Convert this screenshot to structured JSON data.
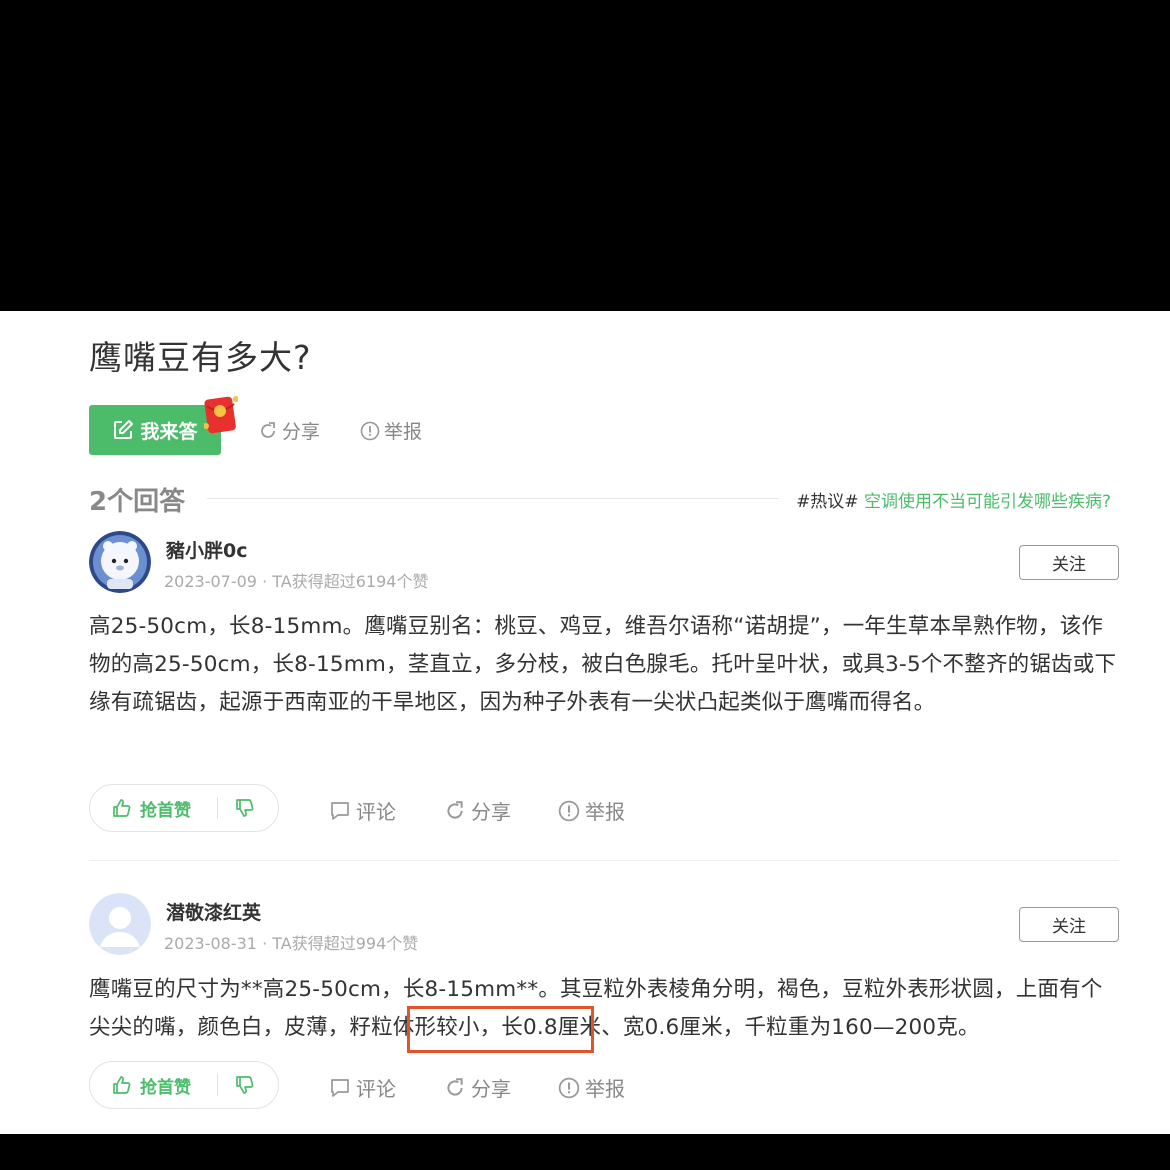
{
  "question": {
    "title": "鹰嘴豆有多大?",
    "answer_button": "我来答",
    "share": "分享",
    "report": "举报"
  },
  "answers_header": {
    "count": "2个回答",
    "hot_tag": "#热议#",
    "hot_link": "空调使用不当可能引发哪些疾病?"
  },
  "answers": [
    {
      "username": "豬小胖0c",
      "meta": "2023-07-09 · TA获得超过6194个赞",
      "follow": "关注",
      "text": "高25-50cm，长8-15mm。鹰嘴豆别名：桃豆、鸡豆，维吾尔语称“诺胡提”，一年生草本旱熟作物，该作物的高25-50cm，长8-15mm，茎直立，多分枝，被白色腺毛。托叶呈叶状，或具3-5个不整齐的锯齿或下缘有疏锯齿，起源于西南亚的干旱地区，因为种子外表有一尖状凸起类似于鹰嘴而得名。",
      "like": "抢首赞",
      "comment": "评论",
      "share": "分享",
      "report": "举报"
    },
    {
      "username": "潜敬漆红英",
      "meta": "2023-08-31 · TA获得超过994个赞",
      "follow": "关注",
      "text": "鹰嘴豆的尺寸为**高25-50cm，长8-15mm**。其豆粒外表棱角分明，褐色，豆粒外表形状圆，上面有个尖尖的嘴，颜色白，皮薄，籽粒体形较小，长0.8厘米、宽0.6厘米，千粒重为160—200克。",
      "like": "抢首赞",
      "comment": "评论",
      "share": "分享",
      "report": "举报"
    }
  ],
  "colors": {
    "accent": "#4cbc6b",
    "highlight_box": "#e2522b",
    "background_bar": "#000000"
  }
}
